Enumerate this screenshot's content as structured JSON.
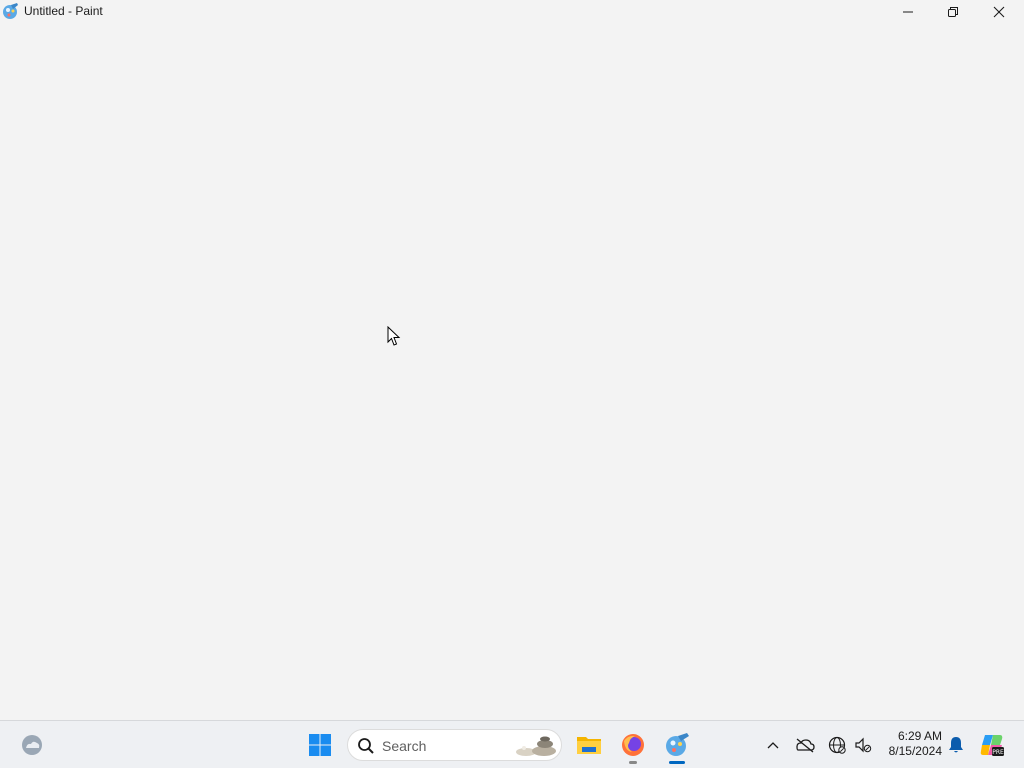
{
  "window": {
    "title": "Untitled - Paint",
    "app_icon": "paint-icon",
    "controls": [
      "minimize-icon",
      "restore-icon",
      "close-icon"
    ]
  },
  "canvas": {
    "background": "#f3f3f3"
  },
  "taskbar": {
    "widgets_icon": "weather-widget-icon",
    "start_icon": "windows-start-icon",
    "search": {
      "placeholder": "Search"
    },
    "pinned_apps": [
      "file-explorer-icon",
      "firefox-icon",
      "paint-icon"
    ],
    "tray": {
      "icons": [
        "chevron-up-icon",
        "onedrive-icon",
        "network-icon",
        "sound-icon"
      ],
      "time": "6:29 AM",
      "date": "8/15/2024"
    },
    "notification_icon": "bell-icon",
    "copilot_icon": "copilot-icon",
    "accent_color": "#0067c0"
  }
}
